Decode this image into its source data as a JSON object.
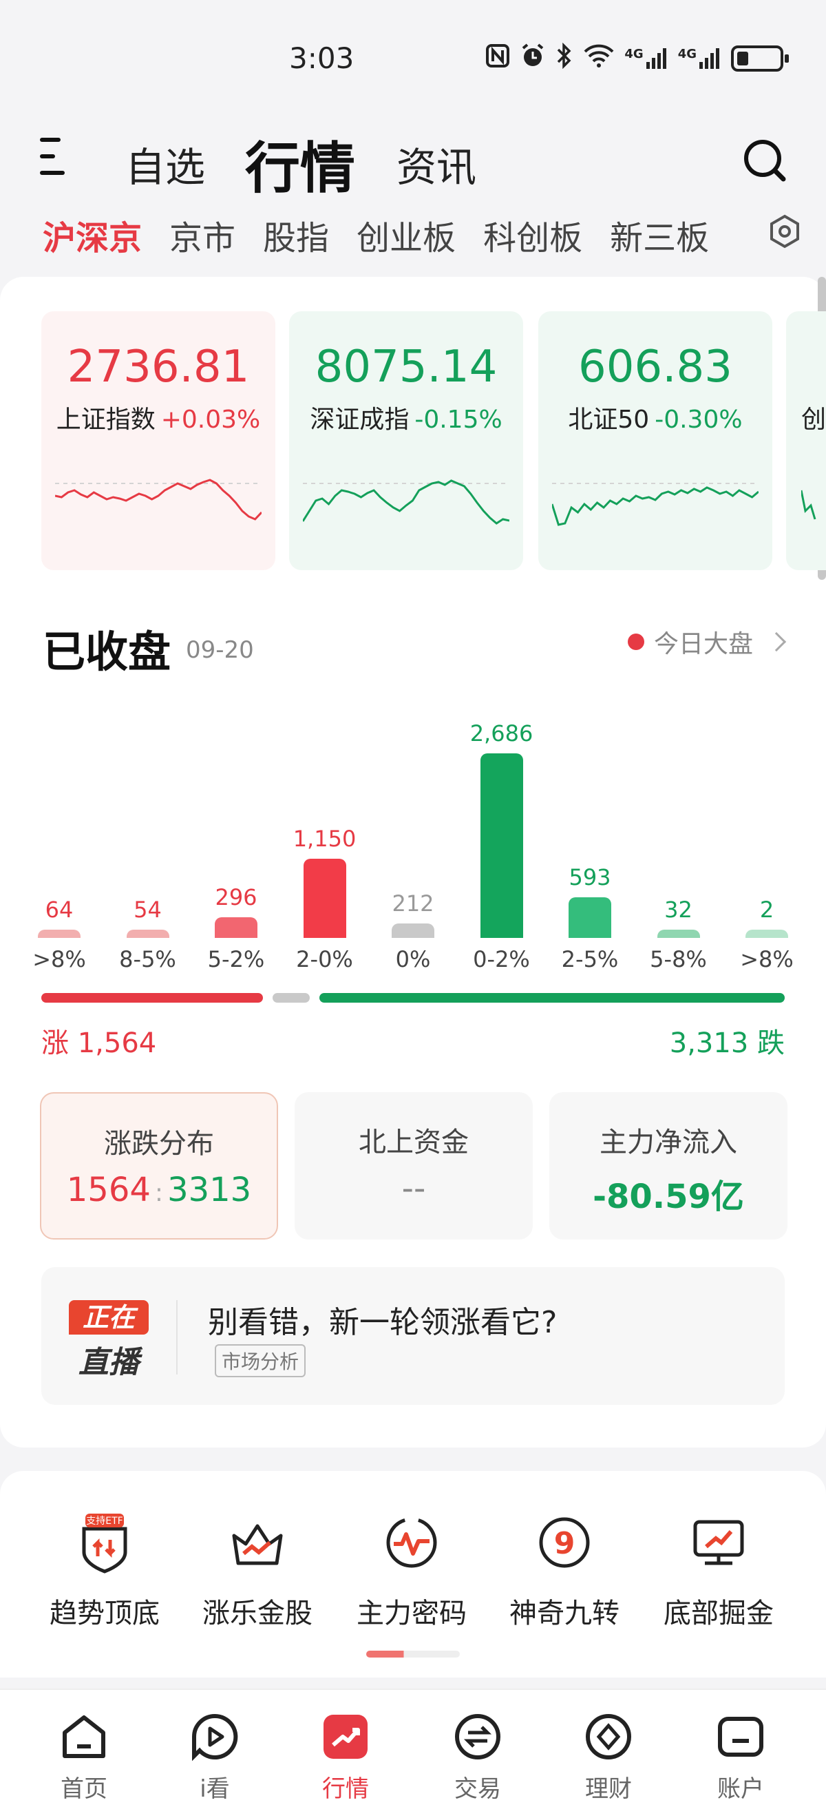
{
  "status_bar": {
    "time": "3:03",
    "icons": [
      "nfc-icon",
      "alarm-icon",
      "bluetooth-icon",
      "wifi-icon",
      "signal-4g-icon",
      "signal-4g-icon",
      "battery-icon"
    ],
    "network_1": "4G",
    "network_2": "4G"
  },
  "header": {
    "tabs": [
      "自选",
      "行情",
      "资讯"
    ],
    "active_tab": "行情"
  },
  "market_tabs": [
    "沪深京",
    "京市",
    "股指",
    "创业板",
    "科创板",
    "新三板"
  ],
  "indices": [
    {
      "value": "2736.81",
      "name": "上证指数",
      "change": "+0.03%",
      "trend": "up",
      "spark": [
        52,
        50,
        57,
        60,
        54,
        50,
        57,
        52,
        47,
        50,
        48,
        45,
        50,
        55,
        52,
        47,
        52,
        60,
        65,
        70,
        66,
        62,
        68,
        72,
        75,
        70,
        60,
        52,
        42,
        30,
        22,
        18,
        28
      ]
    },
    {
      "value": "8075.14",
      "name": "深证成指",
      "change": "-0.15%",
      "trend": "down",
      "spark": [
        15,
        30,
        45,
        48,
        40,
        52,
        60,
        58,
        55,
        50,
        56,
        60,
        50,
        42,
        35,
        30,
        38,
        45,
        60,
        65,
        70,
        72,
        68,
        74,
        70,
        66,
        55,
        42,
        30,
        20,
        12,
        18,
        16
      ]
    },
    {
      "value": "606.83",
      "name": "北证50",
      "change": "-0.30%",
      "trend": "down",
      "spark": [
        40,
        10,
        12,
        35,
        28,
        40,
        32,
        42,
        35,
        45,
        40,
        48,
        44,
        52,
        48,
        50,
        46,
        55,
        58,
        54,
        60,
        56,
        62,
        58,
        64,
        60,
        55,
        58,
        52,
        60,
        55,
        50,
        58
      ]
    },
    {
      "value": "",
      "name": "创",
      "change": "",
      "trend": "up",
      "spark": []
    }
  ],
  "market": {
    "title": "已收盘",
    "date": "09-20",
    "today_link": "今日大盘"
  },
  "chart_data": {
    "type": "bar",
    "categories": [
      ">8%",
      "8-5%",
      "5-2%",
      "2-0%",
      "0%",
      "0-2%",
      "2-5%",
      "5-8%",
      ">8%"
    ],
    "values": [
      64,
      54,
      296,
      1150,
      212,
      2686,
      593,
      32,
      2
    ],
    "labels": [
      "64",
      "54",
      "296",
      "1,150",
      "212",
      "2,686",
      "593",
      "32",
      "2"
    ],
    "colors": [
      "#f2aeae",
      "#f2aeae",
      "#f26670",
      "#f23c48",
      "#c9c9c9",
      "#14a55c",
      "#34bd7c",
      "#8fd6b0",
      "#b6e4cb"
    ]
  },
  "summary": {
    "rise_label": "涨 1,564",
    "fall_label": "3,313 跌",
    "rise_count": 1564,
    "flat_count": 212,
    "fall_count": 3313
  },
  "stats": [
    {
      "title": "涨跌分布",
      "up": "1564",
      "down": "3313"
    },
    {
      "title": "北上资金",
      "value": "--"
    },
    {
      "title": "主力净流入",
      "value": "-80.59亿"
    }
  ],
  "live": {
    "badge_top": "正在",
    "badge_bottom": "直播",
    "title": "别看错，新一轮领涨看它?",
    "tag": "市场分析"
  },
  "tools": [
    {
      "label": "趋势顶底",
      "icon": "trend-shield-icon",
      "badge": "支持ETF"
    },
    {
      "label": "涨乐金股",
      "icon": "crown-chart-icon"
    },
    {
      "label": "主力密码",
      "icon": "pulse-circle-icon"
    },
    {
      "label": "神奇九转",
      "icon": "nine-circle-icon",
      "digit": "9"
    },
    {
      "label": "底部掘金",
      "icon": "monitor-chart-icon"
    }
  ],
  "bottom_nav": [
    {
      "label": "首页",
      "icon": "home-icon"
    },
    {
      "label": "i看",
      "icon": "play-bubble-icon"
    },
    {
      "label": "行情",
      "icon": "market-chart-icon",
      "active": true
    },
    {
      "label": "交易",
      "icon": "exchange-icon"
    },
    {
      "label": "理财",
      "icon": "diamond-icon"
    },
    {
      "label": "账户",
      "icon": "account-icon"
    }
  ],
  "colors": {
    "up": "#e63a44",
    "down": "#14a05a",
    "accent": "#e63a44"
  }
}
